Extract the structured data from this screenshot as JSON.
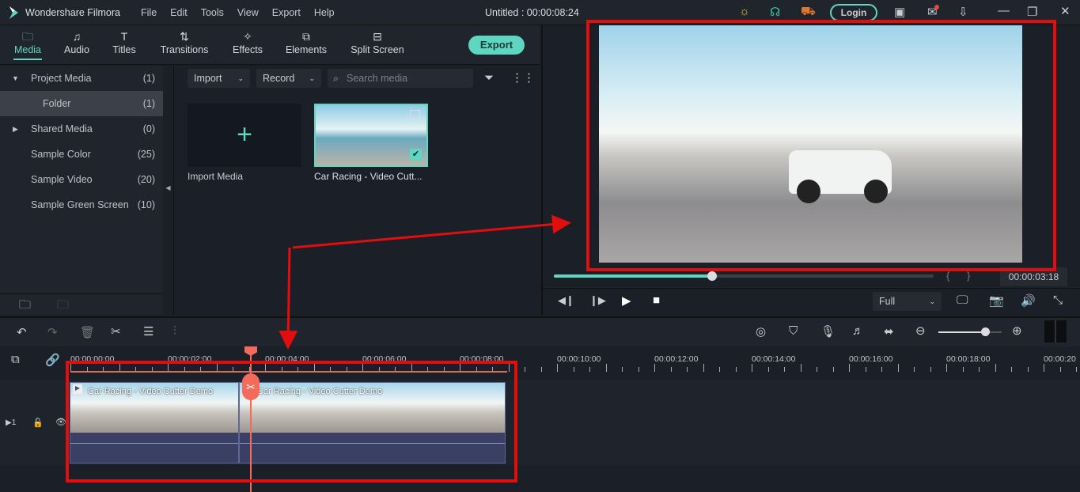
{
  "app": {
    "name": "Wondershare Filmora",
    "title": "Untitled : 00:00:08:24",
    "menu": [
      "File",
      "Edit",
      "Tools",
      "View",
      "Export",
      "Help"
    ],
    "login": "Login"
  },
  "nav": {
    "tabs": [
      {
        "label": "Media",
        "icon": "folder-icon"
      },
      {
        "label": "Audio",
        "icon": "music-icon"
      },
      {
        "label": "Titles",
        "icon": "text-icon"
      },
      {
        "label": "Transitions",
        "icon": "transitions-icon"
      },
      {
        "label": "Effects",
        "icon": "effects-icon"
      },
      {
        "label": "Elements",
        "icon": "elements-icon"
      },
      {
        "label": "Split Screen",
        "icon": "split-screen-icon"
      }
    ],
    "active": "Media",
    "export": "Export"
  },
  "sidebar": {
    "items": [
      {
        "label": "Project Media",
        "count": "(1)"
      },
      {
        "label": "Folder",
        "count": "(1)"
      },
      {
        "label": "Shared Media",
        "count": "(0)"
      },
      {
        "label": "Sample Color",
        "count": "(25)"
      },
      {
        "label": "Sample Video",
        "count": "(20)"
      },
      {
        "label": "Sample Green Screen",
        "count": "(10)"
      }
    ]
  },
  "media": {
    "import": "Import",
    "record": "Record",
    "search_placeholder": "Search media",
    "items": [
      {
        "label": "Import Media"
      },
      {
        "label": "Car Racing - Video Cutt..."
      }
    ]
  },
  "preview": {
    "time": "00:00:03:18",
    "progress": 0.41,
    "quality": "Full"
  },
  "timeline": {
    "ticks": [
      "00:00:00:00",
      "00:00:02:00",
      "00:00:04:00",
      "00:00:06:00",
      "00:00:08:00",
      "00:00:10:00",
      "00:00:12:00",
      "00:00:14:00",
      "00:00:16:00",
      "00:00:18:00",
      "00:00:20"
    ],
    "zoom": 0.75,
    "clips": [
      {
        "label": "Car Racing - Video Cutter Demo"
      },
      {
        "label": "Car Racing - Video Cutter Demo"
      }
    ],
    "track": "1"
  },
  "colors": {
    "accent": "#5fd6c1",
    "playhead": "#f26b5b",
    "annotation": "#e20d0d"
  }
}
